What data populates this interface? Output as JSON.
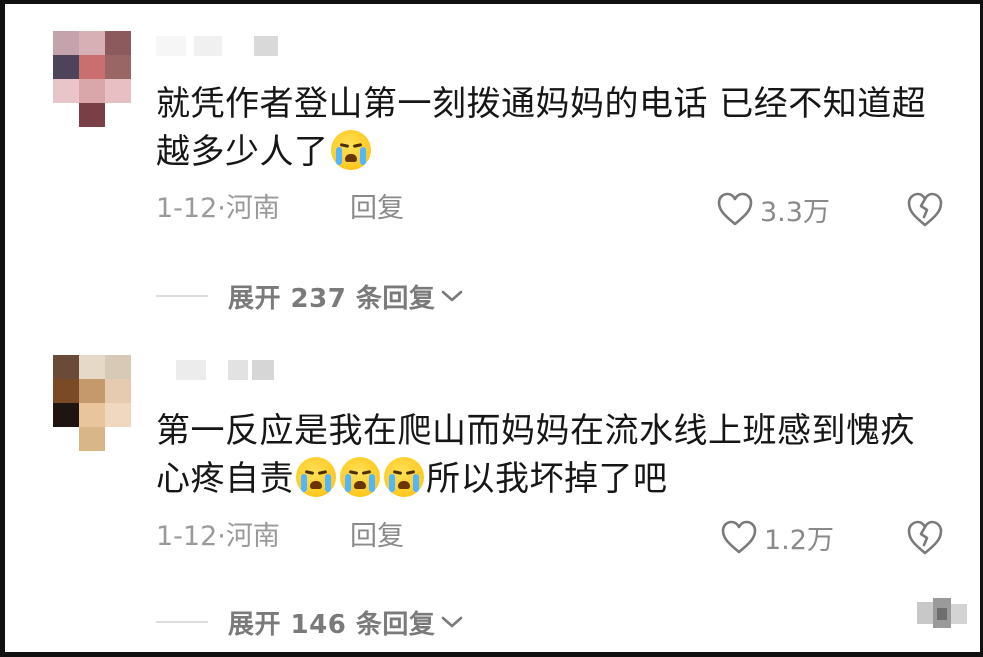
{
  "comments": [
    {
      "text_before_emoji": "就凭作者登山第一刻拨通妈妈的电话 已经不知道超越多少人了",
      "text_after_emoji": "",
      "emoji_count": 1,
      "date_location": "1-12·河南",
      "reply_label": "回复",
      "likes": "3.3万",
      "expand_label": "展开 237 条回复"
    },
    {
      "text_before_emoji": "第一反应是我在爬山而妈妈在流水线上班感到愧疚心疼自责",
      "text_after_emoji": "所以我坏掉了吧",
      "emoji_count": 3,
      "date_location": "1-12·河南",
      "reply_label": "回复",
      "likes": "1.2万",
      "expand_label": "展开 146 条回复"
    }
  ],
  "icons": {
    "like": "heart-outline-icon",
    "dislike": "broken-heart-icon",
    "expand": "chevron-down-icon",
    "emoji": "loudly-crying-face-icon"
  },
  "colors": {
    "text": "#161616",
    "meta": "#9a9a9a",
    "background": "#ffffff"
  }
}
